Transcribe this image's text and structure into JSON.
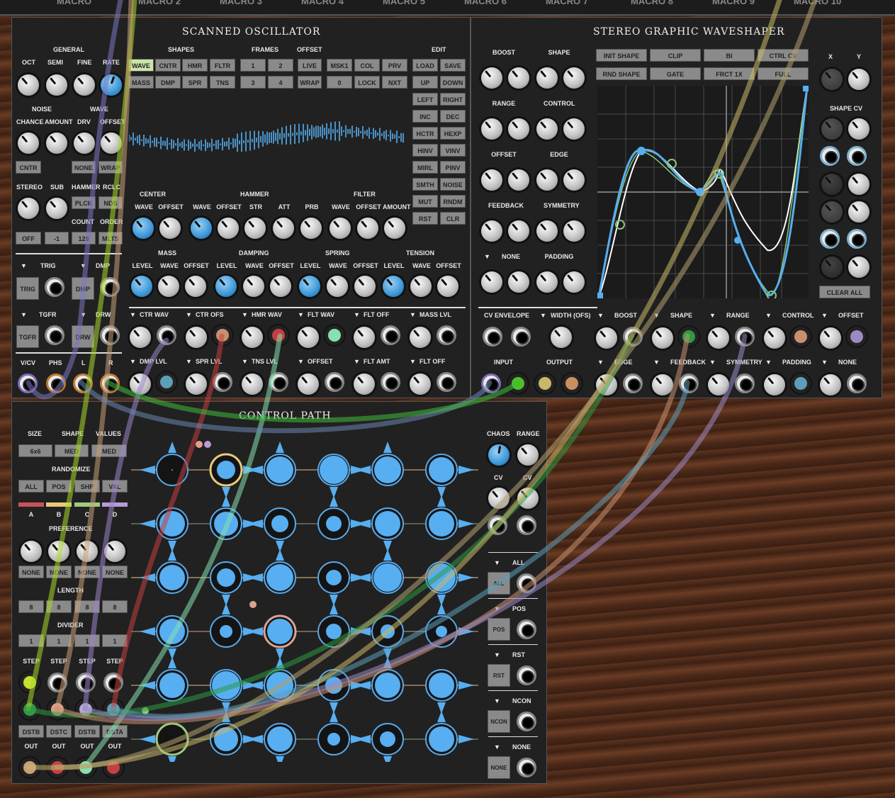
{
  "top_labels": [
    "MACRO",
    "MACRO 2",
    "MACRO 3",
    "MACRO 4",
    "MACRO 5",
    "MACRO 6",
    "MACRO 7",
    "MACRO 8",
    "MACRO 9",
    "MACRO 10"
  ],
  "scanned": {
    "title": "SCANNED OSCILLATOR",
    "general": "GENERAL",
    "oct": "OCT",
    "semi": "SEMI",
    "fine": "FINE",
    "rate": "RATE",
    "shapes": "SHAPES",
    "frames": "FRAMES",
    "offset": "OFFSET",
    "edit": "EDIT",
    "shape_btns": [
      "WAVE",
      "CNTR",
      "HMR",
      "FLTR",
      "MASS",
      "DMP",
      "SPR",
      "TNS"
    ],
    "frame_btns": [
      "1",
      "2",
      "3",
      "4"
    ],
    "offset_btns": [
      "LIVE",
      "MSK1",
      "COL",
      "PRV",
      "WRAP",
      "0",
      "LOCK",
      "NXT"
    ],
    "edit_btns": [
      "LOAD",
      "SAVE",
      "UP",
      "DOWN",
      "LEFT",
      "RIGHT",
      "INC",
      "DEC",
      "HCTR",
      "HEXP",
      "HINV",
      "VINV",
      "MIRL",
      "PINV",
      "SMTH",
      "NOISE",
      "MUT",
      "RNDM",
      "RST",
      "CLR"
    ],
    "noise": "NOISE",
    "wave": "WAVE",
    "chance": "CHANCE",
    "amount": "AMOUNT",
    "drv": "DRV",
    "offset2": "OFFSET",
    "cntr_btn": "CNTR",
    "none_btn": "NONE",
    "wrap_btn": "WRAP",
    "stereo": "STEREO",
    "sub": "SUB",
    "hammer": "HAMMER",
    "rclc": "RCLC",
    "plck": "PLCK",
    "nds": "NDS",
    "count": "COUNT",
    "order": "ORDER",
    "off_btn": "OFF",
    "m1_btn": "-1",
    "c128_btn": "128",
    "mlt_btn": "MLTS",
    "center": "CENTER",
    "hammer2": "HAMMER",
    "filter": "FILTER",
    "row1": [
      "WAVE",
      "OFFSET",
      "WAVE",
      "OFFSET",
      "STR",
      "ATT",
      "PRB",
      "WAVE",
      "OFFSET",
      "AMOUNT"
    ],
    "mass": "MASS",
    "damping": "DAMPING",
    "spring": "SPRING",
    "tension": "TENSION",
    "row2": [
      "LEVEL",
      "WAVE",
      "OFFSET",
      "LEVEL",
      "WAVE",
      "OFFSET",
      "LEVEL",
      "WAVE",
      "OFFSET",
      "LEVEL",
      "WAVE",
      "OFFSET"
    ],
    "trig": "TRIG",
    "dmp": "DMP",
    "tgfr": "TGFR",
    "drw": "DRW",
    "trig_btn": "TRIG",
    "dmp_btn": "DMP",
    "tgfr_btn": "TGFR",
    "drw_btn": "DRW",
    "cv_row1": [
      "CTR WAV",
      "CTR OFS",
      "HMR WAV",
      "FLT WAV",
      "FLT OFF",
      "MASS LVL"
    ],
    "cv_row2": [
      "DMP LVL",
      "SPR LVL",
      "TNS LVL",
      "OFFSET",
      "FLT AMT",
      "FLT OFF"
    ],
    "io": [
      "V/CV",
      "PHS",
      "L",
      "R"
    ]
  },
  "waveshaper": {
    "title": "STEREO GRAPHIC WAVESHAPER",
    "knob_labels": [
      "BOOST",
      "SHAPE",
      "RANGE",
      "CONTROL",
      "OFFSET",
      "EDGE",
      "FEEDBACK",
      "SYMMETRY",
      "NONE",
      "PADDING"
    ],
    "top_btns": [
      "INIT SHAPE",
      "CLIP",
      "BI",
      "CTRL CV",
      "RND SHAPE",
      "GATE",
      "FRCT 1X",
      "FULL"
    ],
    "x": "X",
    "y": "Y",
    "shape_cv": "SHAPE CV",
    "clear_all": "CLEAR ALL",
    "cv_env": "CV ENVELOPE",
    "width": "WIDTH (OFS)",
    "input": "INPUT",
    "output": "OUTPUT",
    "cv_row1": [
      "BOOST",
      "SHAPE",
      "RANGE",
      "CONTROL",
      "OFFSET"
    ],
    "cv_row2": [
      "EDGE",
      "FEEDBACK",
      "SYMMETRY",
      "PADDING",
      "NONE"
    ]
  },
  "control": {
    "title": "CONTROL PATH",
    "size": "SIZE",
    "shape": "SHAPE",
    "values": "VALUES",
    "size_btn": "6x6",
    "shape_btn": "MED",
    "values_btn": "MED",
    "randomize": "RANDOMIZE",
    "rand_btns": [
      "ALL",
      "POS",
      "SHP",
      "VAL"
    ],
    "abcd": [
      "A",
      "B",
      "C",
      "D"
    ],
    "preference": "PREFERENCE",
    "pref_btns": [
      "NONE",
      "NONE",
      "NONE",
      "NONE"
    ],
    "length": "LENGTH",
    "length_btns": [
      "8",
      "8",
      "8",
      "8"
    ],
    "divider": "DIVIDER",
    "div_btns": [
      "1",
      "1",
      "1",
      "1"
    ],
    "step": "STEP",
    "dstb": [
      "DSTB",
      "DSTC",
      "DSTB",
      "DSTA"
    ],
    "out": "OUT",
    "chaos": "CHAOS",
    "range": "RANGE",
    "cv": "CV",
    "right": [
      "ALL",
      "POS",
      "RST",
      "NCON",
      "NONE"
    ]
  },
  "colors": {
    "accent": "#57aef0",
    "panel": "#212121",
    "button": "#8a8a8a"
  }
}
